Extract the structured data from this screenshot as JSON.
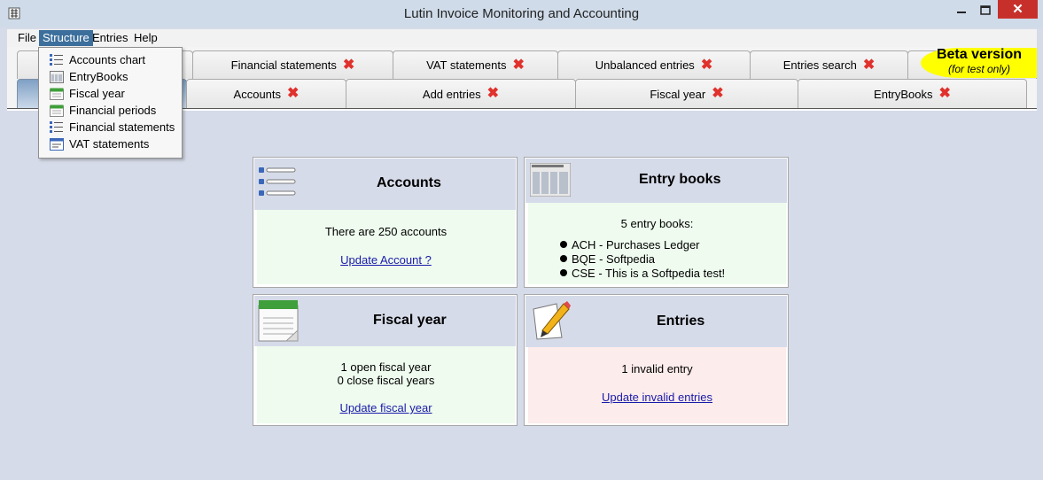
{
  "window": {
    "title": "Lutin Invoice Monitoring and Accounting",
    "close": "✕"
  },
  "menubar": {
    "items": [
      "File",
      "Structure",
      "Entries",
      "Help"
    ]
  },
  "structure_menu": {
    "items": [
      {
        "label": "Accounts chart",
        "icon": "list-icon"
      },
      {
        "label": "EntryBooks",
        "icon": "book-icon"
      },
      {
        "label": "Fiscal year",
        "icon": "calendar-icon"
      },
      {
        "label": "Financial periods",
        "icon": "calendar-icon"
      },
      {
        "label": "Financial statements",
        "icon": "list-icon"
      },
      {
        "label": "VAT statements",
        "icon": "form-icon"
      }
    ]
  },
  "tabs": {
    "row1": [
      "Financial statements",
      "VAT statements",
      "Unbalanced entries",
      "Entries search"
    ],
    "row2": [
      "Accounts",
      "Add entries",
      "Fiscal year",
      "EntryBooks"
    ],
    "close_glyph": "✖"
  },
  "beta": {
    "title": "Beta version",
    "subtitle": "(for test only)"
  },
  "cards": {
    "accounts": {
      "title": "Accounts",
      "text": "There are 250 accounts",
      "link": "Update Account ?"
    },
    "entry_books": {
      "title": "Entry books",
      "text": "5 entry books:",
      "items": [
        "ACH - Purchases Ledger",
        "BQE - Softpedia",
        "CSE - This is a Softpedia test!"
      ]
    },
    "fiscal_year": {
      "title": "Fiscal year",
      "line1": "1 open fiscal year",
      "line2": "0 close fiscal years",
      "link": "Update fiscal year"
    },
    "entries": {
      "title": "Entries",
      "text": "1 invalid entry",
      "link": "Update invalid entries"
    }
  },
  "colors": {
    "accent": "#3c6f9c",
    "close_red": "#e0312c",
    "beta_yellow": "#ffff00",
    "card_green": "#eefbee",
    "card_red": "#fceceb"
  }
}
